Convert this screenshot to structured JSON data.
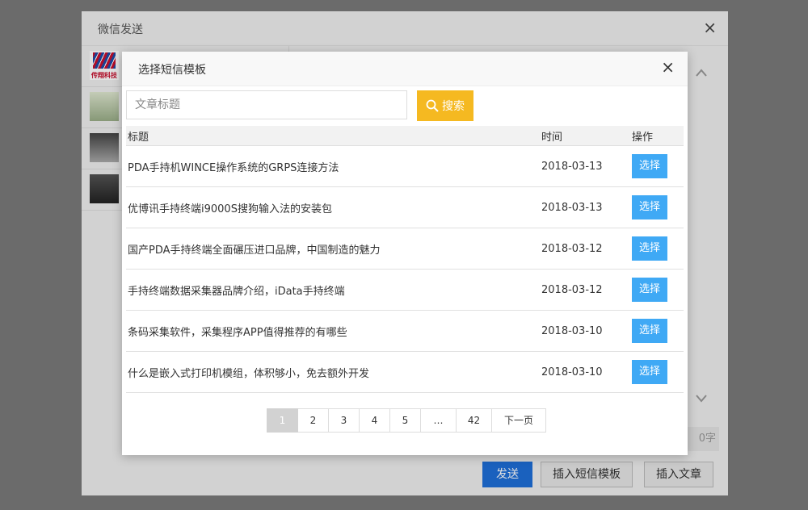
{
  "outer": {
    "title": "微信发送",
    "close": "×",
    "logo_text": "传翔科技",
    "char_count": "0字",
    "send_label": "发送",
    "insert_template_label": "插入短信模板",
    "insert_article_label": "插入文章"
  },
  "modal": {
    "title": "选择短信模板",
    "close": "×",
    "search": {
      "placeholder": "文章标题",
      "value": "",
      "button_label": "搜索"
    },
    "columns": {
      "title": "标题",
      "time": "时间",
      "action": "操作"
    },
    "rows": [
      {
        "title": "PDA手持机WINCE操作系统的GRPS连接方法",
        "time": "2018-03-13",
        "action": "选择"
      },
      {
        "title": "优博讯手持终端i9000S搜狗输入法的安装包",
        "time": "2018-03-13",
        "action": "选择"
      },
      {
        "title": "国产PDA手持终端全面碾压进口品牌，中国制造的魅力",
        "time": "2018-03-12",
        "action": "选择"
      },
      {
        "title": "手持终端数据采集器品牌介绍，iData手持终端",
        "time": "2018-03-12",
        "action": "选择"
      },
      {
        "title": "条码采集软件，采集程序APP值得推荐的有哪些",
        "time": "2018-03-10",
        "action": "选择"
      },
      {
        "title": "什么是嵌入式打印机模组，体积够小，免去额外开发",
        "time": "2018-03-10",
        "action": "选择"
      }
    ],
    "pagination": {
      "pages": [
        "1",
        "2",
        "3",
        "4",
        "5",
        "…",
        "42"
      ],
      "current": "1",
      "next_label": "下一页"
    }
  },
  "colors": {
    "search_button": "#f5b921",
    "select_button": "#3fa9f5",
    "send_button": "#1e6fd9"
  },
  "icons": {
    "close": "close-icon",
    "search": "search-icon",
    "scroll_up": "chevron-up-icon",
    "scroll_down": "chevron-down-icon"
  }
}
